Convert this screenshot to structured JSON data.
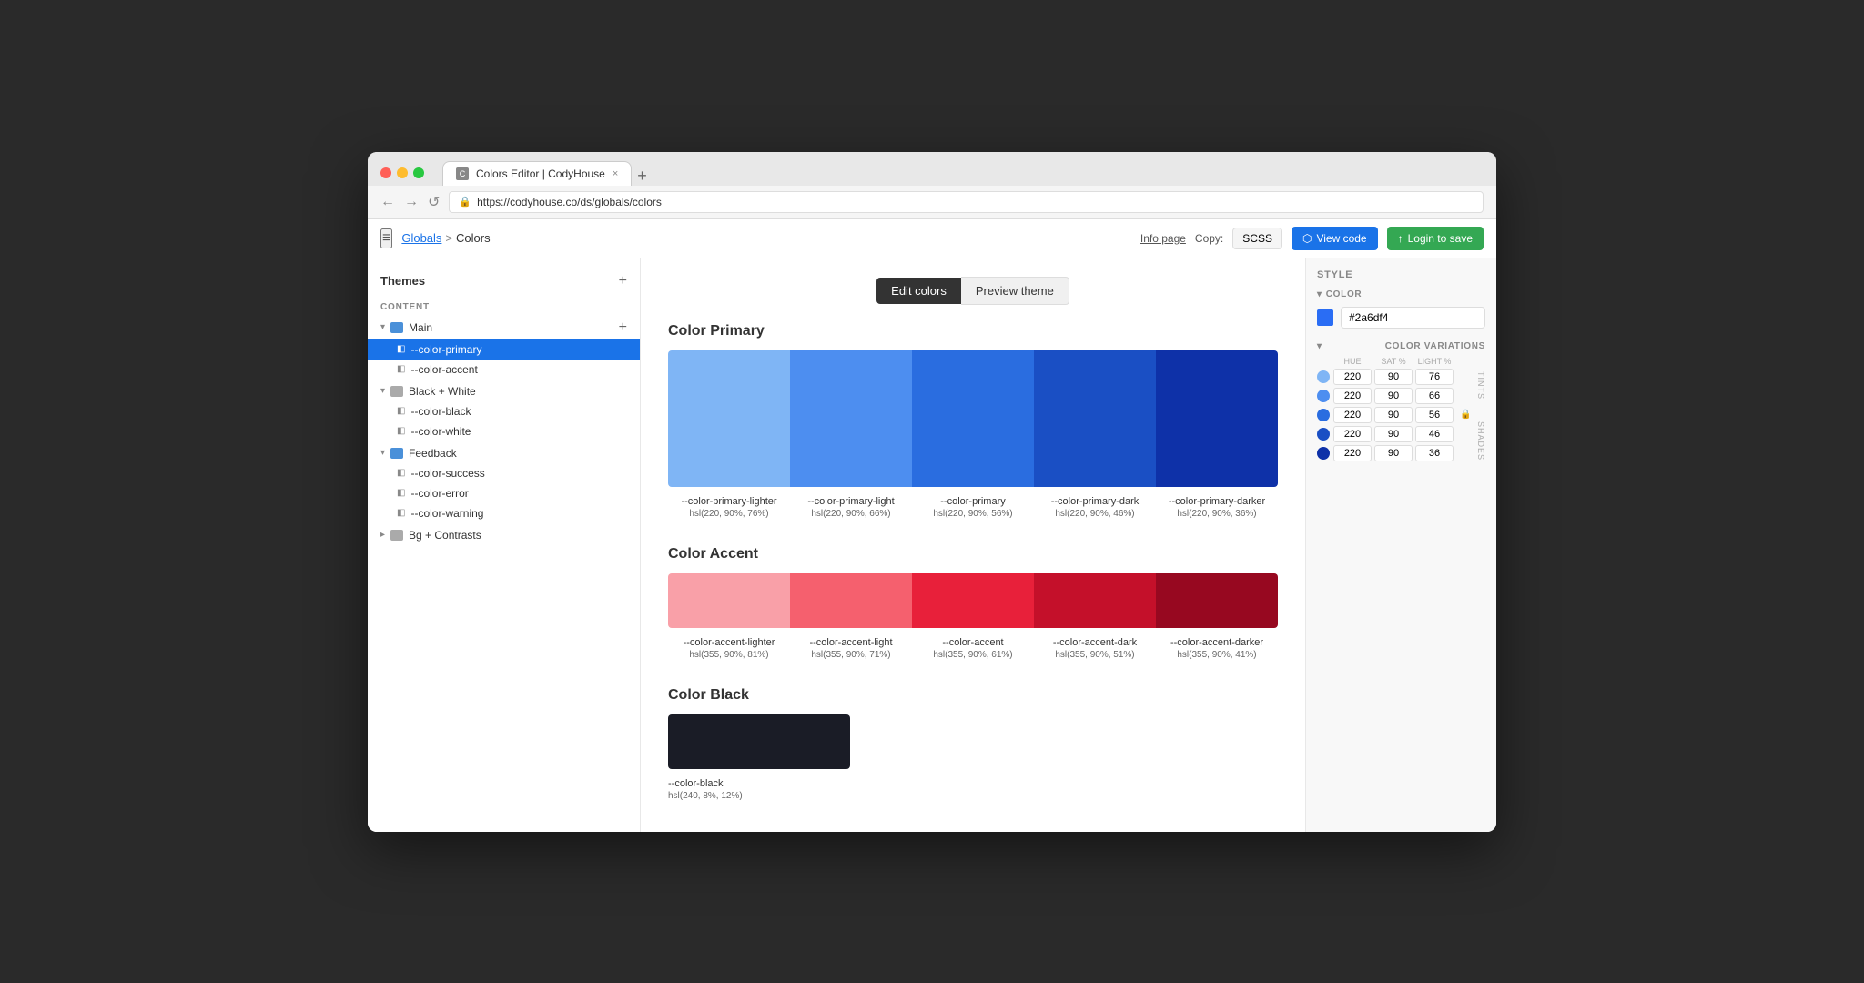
{
  "browser": {
    "tab_title": "Colors Editor | CodyHouse",
    "url": "https://codyhouse.co/ds/globals/colors",
    "tab_close": "×",
    "tab_add": "+",
    "nav_back": "←",
    "nav_forward": "→",
    "nav_reload": "↺"
  },
  "toolbar": {
    "hamburger": "≡",
    "breadcrumb_globals": "Globals",
    "breadcrumb_sep": ">",
    "breadcrumb_colors": "Colors",
    "info_page": "Info page",
    "copy_label": "Copy:",
    "scss_label": "SCSS",
    "view_code_label": "View code",
    "login_save_label": "Login to save"
  },
  "sidebar": {
    "themes_title": "Themes",
    "add_btn": "+",
    "content_label": "CONTENT",
    "main_group": "Main",
    "items": [
      {
        "id": "color-primary",
        "label": "--color-primary",
        "active": true
      },
      {
        "id": "color-accent",
        "label": "--color-accent",
        "active": false
      }
    ],
    "black_white_group": "Black + White",
    "black_white_items": [
      {
        "id": "color-black",
        "label": "--color-black"
      },
      {
        "id": "color-white",
        "label": "--color-white"
      }
    ],
    "feedback_group": "Feedback",
    "feedback_items": [
      {
        "id": "color-success",
        "label": "--color-success"
      },
      {
        "id": "color-error",
        "label": "--color-error"
      },
      {
        "id": "color-warning",
        "label": "--color-warning"
      }
    ],
    "bg_contrasts_group": "Bg + Contrasts"
  },
  "edit_bar": {
    "edit_colors": "Edit colors",
    "preview_theme": "Preview theme"
  },
  "color_primary": {
    "title": "Color Primary",
    "swatches": [
      {
        "id": "lighter",
        "color": "#7fb5f5",
        "name": "--color-primary-lighter",
        "value": "hsl(220, 90%, 76%)"
      },
      {
        "id": "light",
        "color": "#4d8ef0",
        "name": "--color-primary-light",
        "value": "hsl(220, 90%, 66%)"
      },
      {
        "id": "base",
        "color": "#2a6de0",
        "name": "--color-primary",
        "value": "hsl(220, 90%, 56%)"
      },
      {
        "id": "dark",
        "color": "#1a4fc4",
        "name": "--color-primary-dark",
        "value": "hsl(220, 90%, 46%)"
      },
      {
        "id": "darker",
        "color": "#0e31a8",
        "name": "--color-primary-darker",
        "value": "hsl(220, 90%, 36%)"
      }
    ]
  },
  "color_accent": {
    "title": "Color Accent",
    "swatches": [
      {
        "id": "lighter",
        "color": "#f9a0a8",
        "name": "--color-accent-lighter",
        "value": "hsl(355, 90%, 81%)"
      },
      {
        "id": "light",
        "color": "#f5606e",
        "name": "--color-accent-light",
        "value": "hsl(355, 90%, 71%)"
      },
      {
        "id": "base",
        "color": "#e8203a",
        "name": "--color-accent",
        "value": "hsl(355, 90%, 61%)"
      },
      {
        "id": "dark",
        "color": "#c4102a",
        "name": "--color-accent-dark",
        "value": "hsl(355, 90%, 51%)"
      },
      {
        "id": "darker",
        "color": "#970820",
        "name": "--color-accent-darker",
        "value": "hsl(355, 90%, 41%)"
      }
    ]
  },
  "color_black": {
    "title": "Color Black",
    "swatches": [
      {
        "id": "base",
        "color": "#1a1c26",
        "name": "--color-black",
        "value": "hsl(240, 8%, 12%)"
      }
    ]
  },
  "right_panel": {
    "style_label": "STYLE",
    "color_section": "COLOR",
    "color_hex": "#2a6df4",
    "color_variations_label": "COLOR VARIATIONS",
    "tints_label": "TINTS",
    "shades_label": "SHADES",
    "variations": [
      {
        "hue": "220",
        "sat": "90",
        "light": "76",
        "color": "#7fb5f5"
      },
      {
        "hue": "220",
        "sat": "90",
        "light": "66",
        "color": "#4d8ef0"
      },
      {
        "hue": "220",
        "sat": "90",
        "light": "56",
        "color": "#2a6de0",
        "locked": true
      },
      {
        "hue": "220",
        "sat": "90",
        "light": "46",
        "color": "#1a4fc4"
      },
      {
        "hue": "220",
        "sat": "90",
        "light": "36",
        "color": "#0e31a8"
      }
    ],
    "col_hue": "HUE",
    "col_sat": "SAT %",
    "col_light": "LIGHT %"
  }
}
